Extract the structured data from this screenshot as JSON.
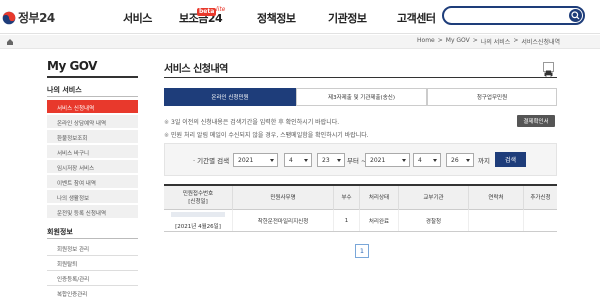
{
  "header": {
    "logo_text": "정부24",
    "nav": [
      "서비스",
      "보조금24",
      "정책정보",
      "기관정보",
      "고객센터"
    ],
    "beta_badge": "beta",
    "lite_label": "lite",
    "search_placeholder": ""
  },
  "breadcrumb": [
    "Home",
    ">",
    "My GOV",
    ">",
    "나의 서비스",
    ">",
    "서비스신청내역"
  ],
  "sidebar": {
    "title": "My GOV",
    "section1": "나의 서비스",
    "items": [
      {
        "label": "서비스 신청내역",
        "active": true
      },
      {
        "label": "온라인 상담예약 내역",
        "active": false
      },
      {
        "label": "환불정보조회",
        "active": false
      },
      {
        "label": "서비스 바구니",
        "active": false
      },
      {
        "label": "임시저장 서비스",
        "active": false
      },
      {
        "label": "이벤트 참여 내역",
        "active": false
      },
      {
        "label": "나의 생활정보",
        "active": false
      },
      {
        "label": "운전및 등록 신청내역",
        "active": false
      }
    ],
    "section2": "회원정보",
    "items2": [
      "회원정보 관리",
      "회원탈퇴",
      "인증등록/관리",
      "복합인증관리"
    ]
  },
  "main": {
    "title": "서비스 신청내역",
    "tabs": [
      "온라인 신청민원",
      "제3자제출 및 기관제출(송신)",
      "청구업무민원"
    ],
    "notices": [
      "3일 이전의 신청내용은 검색기간을 입력한 후 확인하시기 바랍니다.",
      "민원 처리 알림 메일이 수신되지 않을 경우, 스팸메일함을 확인하시기 바랍니다."
    ],
    "history_button": "결제확인서",
    "filter": {
      "label": "· 기간별 검색",
      "from": {
        "year": "2021",
        "month": "4",
        "day": "23"
      },
      "separator": "부터 ~",
      "to": {
        "year": "2021",
        "month": "4",
        "day": "26"
      },
      "suffix": "까지",
      "search_button": "검색"
    },
    "table": {
      "headers": [
        "민원접수번호\n[신청일]",
        "민원사무명",
        "부수",
        "처리상태",
        "교부기관",
        "연락처",
        "추가신청"
      ],
      "rows": [
        {
          "receipt_date": "[2021년 4월26일]",
          "name": "착한운전마일리지신청",
          "copies": "1",
          "status": "처리완료",
          "agency": "경찰청",
          "contact": "",
          "extra": ""
        }
      ]
    },
    "page": "1"
  },
  "colors": {
    "primary": "#1e3d7a",
    "accent": "#e8392c"
  }
}
